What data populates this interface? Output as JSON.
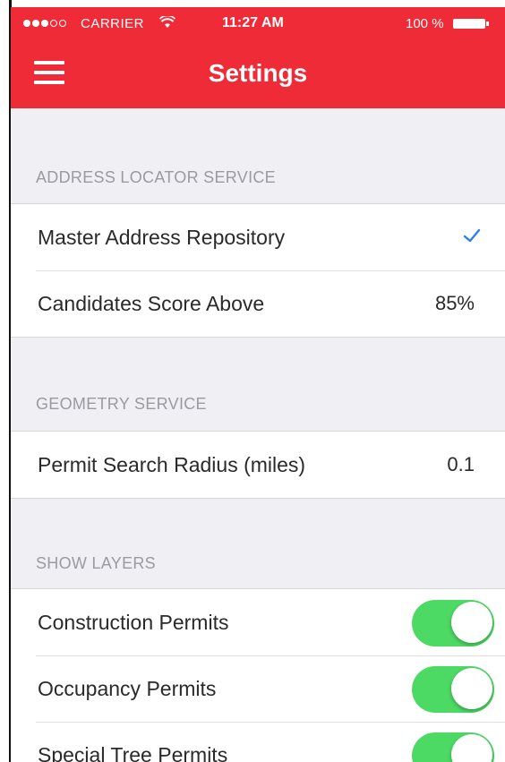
{
  "status_bar": {
    "carrier": "CARRIER",
    "time": "11:27 AM",
    "battery": "100 %"
  },
  "nav": {
    "title": "Settings",
    "menu_icon": "hamburger-menu-icon"
  },
  "sections": {
    "address_locator": {
      "header": "ADDRESS LOCATOR SERVICE",
      "rows": [
        {
          "label": "Master Address Repository",
          "checked": true,
          "icon": "checkmark-icon"
        },
        {
          "label": "Candidates Score Above",
          "value": "85%"
        }
      ]
    },
    "geometry": {
      "header": "GEOMETRY SERVICE",
      "rows": [
        {
          "label": "Permit Search Radius (miles)",
          "value": "0.1"
        }
      ]
    },
    "layers": {
      "header": "SHOW LAYERS",
      "rows": [
        {
          "label": "Construction Permits",
          "on": true
        },
        {
          "label": "Occupancy Permits",
          "on": true
        },
        {
          "label": "Special Tree Permits",
          "on": true
        }
      ]
    }
  },
  "colors": {
    "header_red": "#ee2b36",
    "toggle_green": "#4cd964",
    "check_blue": "#2b7ff0",
    "background": "#efeff4"
  }
}
